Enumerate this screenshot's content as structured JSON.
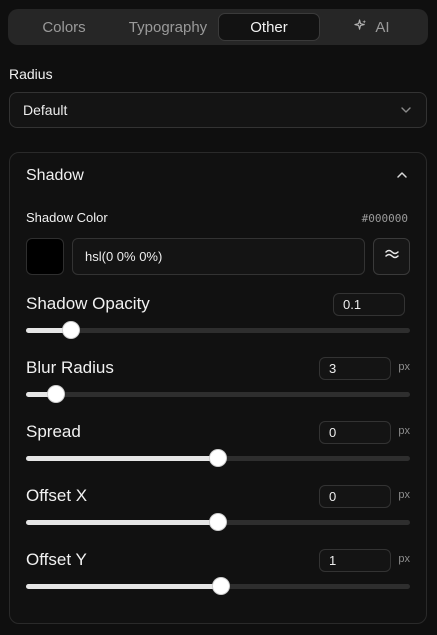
{
  "tabs": [
    {
      "label": "Colors",
      "active": false
    },
    {
      "label": "Typography",
      "active": false
    },
    {
      "label": "Other",
      "active": true
    },
    {
      "label": "AI",
      "active": false,
      "icon": "sparkles-icon"
    }
  ],
  "radius": {
    "label": "Radius",
    "value": "Default"
  },
  "shadow": {
    "title": "Shadow",
    "color_label": "Shadow Color",
    "color_hex": "#000000",
    "color_value": "hsl(0 0% 0%)",
    "swatch_color": "#000000",
    "sliders": [
      {
        "label": "Shadow Opacity",
        "value": "0.1",
        "unit": "",
        "level": 0.117
      },
      {
        "label": "Blur Radius",
        "value": "3",
        "unit": "px",
        "level": 0.078
      },
      {
        "label": "Spread",
        "value": "0",
        "unit": "px",
        "level": 0.5
      },
      {
        "label": "Offset X",
        "value": "0",
        "unit": "px",
        "level": 0.5
      },
      {
        "label": "Offset Y",
        "value": "1",
        "unit": "px",
        "level": 0.508
      }
    ]
  }
}
